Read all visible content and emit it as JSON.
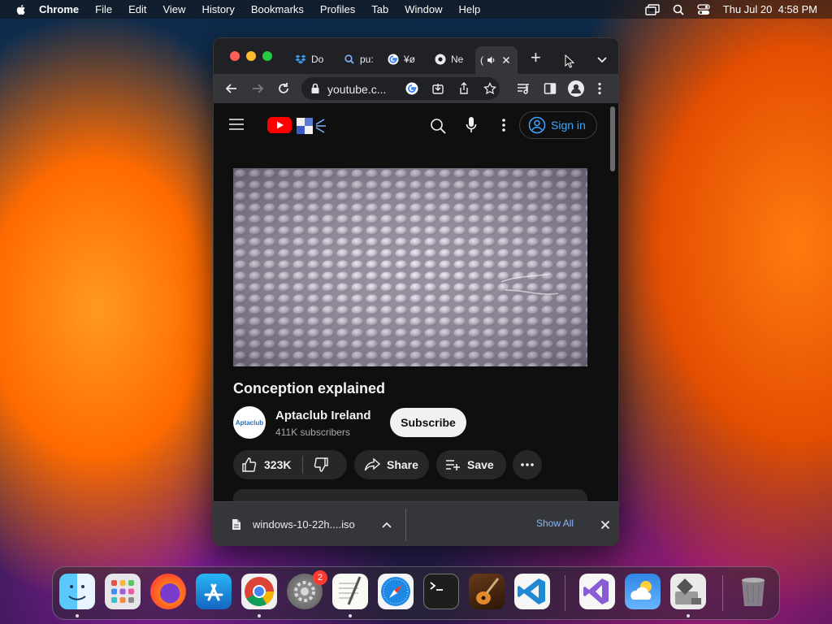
{
  "menubar": {
    "app_name": "Chrome",
    "items": [
      "File",
      "Edit",
      "View",
      "History",
      "Bookmarks",
      "Profiles",
      "Tab",
      "Window",
      "Help"
    ],
    "clock": "Thu Jul 20  4:58 PM"
  },
  "browser": {
    "tabs": [
      {
        "label": "Do",
        "icon": "dropbox-icon"
      },
      {
        "label": "pu:",
        "icon": "search-icon"
      },
      {
        "label": "¥ø",
        "icon": "google-icon"
      },
      {
        "label": "Ne",
        "icon": "chrome-icon"
      },
      {
        "label": "(",
        "icon": "speaker-icon",
        "active": true
      }
    ],
    "new_tab_label": "+",
    "address": "youtube.c...",
    "download": {
      "filename": "windows-10-22h....iso",
      "show_all": "Show All"
    }
  },
  "youtube": {
    "sign_in": "Sign in",
    "video_title": "Conception explained",
    "channel_name": "Aptaclub Ireland",
    "avatar_text": "Aptaclub",
    "subscribers": "411K subscribers",
    "subscribe_label": "Subscribe",
    "likes": "323K",
    "share_label": "Share",
    "save_label": "Save"
  },
  "dock": {
    "apps": [
      "finder",
      "launchpad",
      "firefox",
      "app-store",
      "chrome",
      "system-settings",
      "textedit",
      "safari",
      "terminal",
      "garageband",
      "vscode",
      "visual-studio",
      "weather",
      "migration-assistant",
      "trash"
    ],
    "settings_badge": "2"
  },
  "colors": {
    "youtube_red": "#ff0000",
    "link_blue": "#3ea6ff",
    "chrome_dark": "#202124"
  }
}
